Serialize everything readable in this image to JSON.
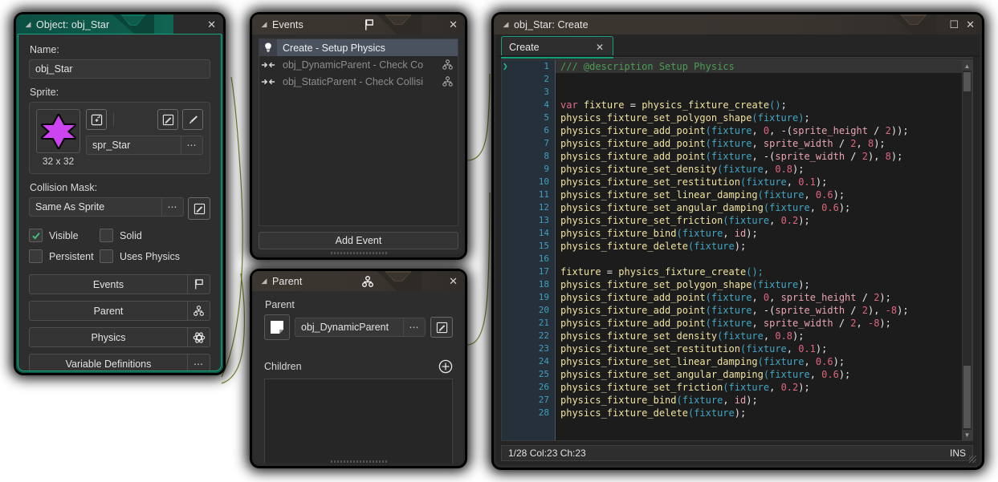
{
  "object_panel": {
    "title": "Object: obj_Star",
    "close_label": "✕",
    "name_label": "Name:",
    "name_value": "obj_Star",
    "sprite_label": "Sprite:",
    "sprite_name": "spr_Star",
    "sprite_dims": "32 x 32",
    "sprite_dots": "⋯",
    "collision_label": "Collision Mask:",
    "collision_value": "Same As Sprite",
    "collision_dots": "⋯",
    "checkboxes": [
      {
        "label": "Visible",
        "checked": true
      },
      {
        "label": "Solid",
        "checked": false
      },
      {
        "label": "Persistent",
        "checked": false
      },
      {
        "label": "Uses Physics",
        "checked": false
      }
    ],
    "buttons": [
      {
        "label": "Events",
        "icon": "flag-icon"
      },
      {
        "label": "Parent",
        "icon": "parent-tree-icon"
      },
      {
        "label": "Physics",
        "icon": "physics-gear-icon"
      },
      {
        "label": "Variable Definitions",
        "icon": "ellipsis-icon"
      }
    ],
    "variable_dots": "⋯",
    "accent_color": "#18a07c"
  },
  "events_panel": {
    "title": "Events",
    "close_label": "✕",
    "items": [
      {
        "label": "Create - Setup Physics",
        "icon": "lightbulb-icon",
        "selected": true,
        "trailing": ""
      },
      {
        "label": "obj_DynamicParent - Check Co",
        "icon": "collision-icon",
        "selected": false,
        "trailing": "parent-tree-icon"
      },
      {
        "label": "obj_StaticParent - Check Collisi",
        "icon": "collision-icon",
        "selected": false,
        "trailing": "parent-tree-icon"
      }
    ],
    "add_event_label": "Add Event"
  },
  "parent_panel": {
    "title": "Parent",
    "close_label": "✕",
    "parent_label": "Parent",
    "parent_value": "obj_DynamicParent",
    "parent_dots": "⋯",
    "children_label": "Children",
    "add_child_icon": "plus-circle-icon"
  },
  "code_panel": {
    "title": "obj_Star: Create",
    "maximize_label": "☐",
    "close_label": "✕",
    "tab_label": "Create",
    "tab_close": "✕",
    "status_left": "1/28 Col:23 Ch:23",
    "status_right": "INS",
    "lines": [
      {
        "n": 1,
        "current": true,
        "tokens": [
          {
            "t": "/// @description Setup Physics",
            "c": "k-com"
          }
        ]
      },
      {
        "n": 2,
        "current": false,
        "tokens": []
      },
      {
        "n": 3,
        "current": false,
        "tokens": []
      },
      {
        "n": 4,
        "current": false,
        "tokens": [
          {
            "t": "var",
            "c": "k-key"
          },
          {
            "t": " ",
            "c": "k-pl"
          },
          {
            "t": "fixture",
            "c": "k-fn"
          },
          {
            "t": " = ",
            "c": "k-pl"
          },
          {
            "t": "physics_fixture_create",
            "c": "k-fn"
          },
          {
            "t": "(",
            "c": "k-var"
          },
          {
            "t": ")",
            "c": "k-var"
          },
          {
            "t": ";",
            "c": "k-pl"
          }
        ]
      },
      {
        "n": 5,
        "current": false,
        "tokens": [
          {
            "t": "physics_fixture_set_polygon_shape",
            "c": "k-fn"
          },
          {
            "t": "(",
            "c": "k-var"
          },
          {
            "t": "fixture",
            "c": "k-var"
          },
          {
            "t": ")",
            "c": "k-var"
          },
          {
            "t": ";",
            "c": "k-pl"
          }
        ]
      },
      {
        "n": 6,
        "current": false,
        "tokens": [
          {
            "t": "physics_fixture_add_point",
            "c": "k-fn"
          },
          {
            "t": "(",
            "c": "k-var"
          },
          {
            "t": "fixture",
            "c": "k-var"
          },
          {
            "t": ", ",
            "c": "k-pl"
          },
          {
            "t": "0",
            "c": "k-num"
          },
          {
            "t": ", -(",
            "c": "k-pl"
          },
          {
            "t": "sprite_height",
            "c": "k-bi"
          },
          {
            "t": " / ",
            "c": "k-pl"
          },
          {
            "t": "2",
            "c": "k-num"
          },
          {
            "t": "));",
            "c": "k-pl"
          }
        ]
      },
      {
        "n": 7,
        "current": false,
        "tokens": [
          {
            "t": "physics_fixture_add_point",
            "c": "k-fn"
          },
          {
            "t": "(",
            "c": "k-var"
          },
          {
            "t": "fixture",
            "c": "k-var"
          },
          {
            "t": ", ",
            "c": "k-pl"
          },
          {
            "t": "sprite_width",
            "c": "k-bi"
          },
          {
            "t": " / ",
            "c": "k-pl"
          },
          {
            "t": "2",
            "c": "k-num"
          },
          {
            "t": ", ",
            "c": "k-pl"
          },
          {
            "t": "8",
            "c": "k-num"
          },
          {
            "t": ");",
            "c": "k-pl"
          }
        ]
      },
      {
        "n": 8,
        "current": false,
        "tokens": [
          {
            "t": "physics_fixture_add_point",
            "c": "k-fn"
          },
          {
            "t": "(",
            "c": "k-var"
          },
          {
            "t": "fixture",
            "c": "k-var"
          },
          {
            "t": ", -(",
            "c": "k-pl"
          },
          {
            "t": "sprite_width",
            "c": "k-bi"
          },
          {
            "t": " / ",
            "c": "k-pl"
          },
          {
            "t": "2",
            "c": "k-num"
          },
          {
            "t": "), ",
            "c": "k-pl"
          },
          {
            "t": "8",
            "c": "k-num"
          },
          {
            "t": ");",
            "c": "k-pl"
          }
        ]
      },
      {
        "n": 9,
        "current": false,
        "tokens": [
          {
            "t": "physics_fixture_set_density",
            "c": "k-fn"
          },
          {
            "t": "(",
            "c": "k-var"
          },
          {
            "t": "fixture",
            "c": "k-var"
          },
          {
            "t": ", ",
            "c": "k-pl"
          },
          {
            "t": "0.8",
            "c": "k-num"
          },
          {
            "t": ");",
            "c": "k-pl"
          }
        ]
      },
      {
        "n": 10,
        "current": false,
        "tokens": [
          {
            "t": "physics_fixture_set_restitution",
            "c": "k-fn"
          },
          {
            "t": "(",
            "c": "k-var"
          },
          {
            "t": "fixture",
            "c": "k-var"
          },
          {
            "t": ", ",
            "c": "k-pl"
          },
          {
            "t": "0.1",
            "c": "k-num"
          },
          {
            "t": ");",
            "c": "k-pl"
          }
        ]
      },
      {
        "n": 11,
        "current": false,
        "tokens": [
          {
            "t": "physics_fixture_set_linear_damping",
            "c": "k-fn"
          },
          {
            "t": "(",
            "c": "k-var"
          },
          {
            "t": "fixture",
            "c": "k-var"
          },
          {
            "t": ", ",
            "c": "k-pl"
          },
          {
            "t": "0.6",
            "c": "k-num"
          },
          {
            "t": ");",
            "c": "k-pl"
          }
        ]
      },
      {
        "n": 12,
        "current": false,
        "tokens": [
          {
            "t": "physics_fixture_set_angular_damping",
            "c": "k-fn"
          },
          {
            "t": "(",
            "c": "k-var"
          },
          {
            "t": "fixture",
            "c": "k-var"
          },
          {
            "t": ", ",
            "c": "k-pl"
          },
          {
            "t": "0.6",
            "c": "k-num"
          },
          {
            "t": ");",
            "c": "k-pl"
          }
        ]
      },
      {
        "n": 13,
        "current": false,
        "tokens": [
          {
            "t": "physics_fixture_set_friction",
            "c": "k-fn"
          },
          {
            "t": "(",
            "c": "k-var"
          },
          {
            "t": "fixture",
            "c": "k-var"
          },
          {
            "t": ", ",
            "c": "k-pl"
          },
          {
            "t": "0.2",
            "c": "k-num"
          },
          {
            "t": ");",
            "c": "k-pl"
          }
        ]
      },
      {
        "n": 14,
        "current": false,
        "tokens": [
          {
            "t": "physics_fixture_bind",
            "c": "k-fn"
          },
          {
            "t": "(",
            "c": "k-var"
          },
          {
            "t": "fixture",
            "c": "k-var"
          },
          {
            "t": ", ",
            "c": "k-pl"
          },
          {
            "t": "id",
            "c": "k-bi"
          },
          {
            "t": ");",
            "c": "k-pl"
          }
        ]
      },
      {
        "n": 15,
        "current": false,
        "tokens": [
          {
            "t": "physics_fixture_delete",
            "c": "k-fn"
          },
          {
            "t": "(",
            "c": "k-var"
          },
          {
            "t": "fixture",
            "c": "k-var"
          },
          {
            "t": ");",
            "c": "k-pl"
          }
        ]
      },
      {
        "n": 16,
        "current": false,
        "tokens": []
      },
      {
        "n": 17,
        "current": false,
        "tokens": [
          {
            "t": "fixture",
            "c": "k-fn"
          },
          {
            "t": " = ",
            "c": "k-pl"
          },
          {
            "t": "physics_fixture_create",
            "c": "k-fn"
          },
          {
            "t": "();",
            "c": "k-var"
          }
        ]
      },
      {
        "n": 18,
        "current": false,
        "tokens": [
          {
            "t": "physics_fixture_set_polygon_shape",
            "c": "k-fn"
          },
          {
            "t": "(",
            "c": "k-var"
          },
          {
            "t": "fixture",
            "c": "k-var"
          },
          {
            "t": ");",
            "c": "k-pl"
          }
        ]
      },
      {
        "n": 19,
        "current": false,
        "tokens": [
          {
            "t": "physics_fixture_add_point",
            "c": "k-fn"
          },
          {
            "t": "(",
            "c": "k-var"
          },
          {
            "t": "fixture",
            "c": "k-var"
          },
          {
            "t": ", ",
            "c": "k-pl"
          },
          {
            "t": "0",
            "c": "k-num"
          },
          {
            "t": ", ",
            "c": "k-pl"
          },
          {
            "t": "sprite_height",
            "c": "k-bi"
          },
          {
            "t": " / ",
            "c": "k-pl"
          },
          {
            "t": "2",
            "c": "k-num"
          },
          {
            "t": ");",
            "c": "k-pl"
          }
        ]
      },
      {
        "n": 20,
        "current": false,
        "tokens": [
          {
            "t": "physics_fixture_add_point",
            "c": "k-fn"
          },
          {
            "t": "(",
            "c": "k-var"
          },
          {
            "t": "fixture",
            "c": "k-var"
          },
          {
            "t": ", -(",
            "c": "k-pl"
          },
          {
            "t": "sprite_width",
            "c": "k-bi"
          },
          {
            "t": " / ",
            "c": "k-pl"
          },
          {
            "t": "2",
            "c": "k-num"
          },
          {
            "t": "), ",
            "c": "k-pl"
          },
          {
            "t": "-8",
            "c": "k-num"
          },
          {
            "t": ");",
            "c": "k-pl"
          }
        ]
      },
      {
        "n": 21,
        "current": false,
        "tokens": [
          {
            "t": "physics_fixture_add_point",
            "c": "k-fn"
          },
          {
            "t": "(",
            "c": "k-var"
          },
          {
            "t": "fixture",
            "c": "k-var"
          },
          {
            "t": ", ",
            "c": "k-pl"
          },
          {
            "t": "sprite_width",
            "c": "k-bi"
          },
          {
            "t": " / ",
            "c": "k-pl"
          },
          {
            "t": "2",
            "c": "k-num"
          },
          {
            "t": ", ",
            "c": "k-pl"
          },
          {
            "t": "-8",
            "c": "k-num"
          },
          {
            "t": ");",
            "c": "k-pl"
          }
        ]
      },
      {
        "n": 22,
        "current": false,
        "tokens": [
          {
            "t": "physics_fixture_set_density",
            "c": "k-fn"
          },
          {
            "t": "(",
            "c": "k-var"
          },
          {
            "t": "fixture",
            "c": "k-var"
          },
          {
            "t": ", ",
            "c": "k-pl"
          },
          {
            "t": "0.8",
            "c": "k-num"
          },
          {
            "t": ");",
            "c": "k-pl"
          }
        ]
      },
      {
        "n": 23,
        "current": false,
        "tokens": [
          {
            "t": "physics_fixture_set_restitution",
            "c": "k-fn"
          },
          {
            "t": "(",
            "c": "k-var"
          },
          {
            "t": "fixture",
            "c": "k-var"
          },
          {
            "t": ", ",
            "c": "k-pl"
          },
          {
            "t": "0.1",
            "c": "k-num"
          },
          {
            "t": ");",
            "c": "k-pl"
          }
        ]
      },
      {
        "n": 24,
        "current": false,
        "tokens": [
          {
            "t": "physics_fixture_set_linear_damping",
            "c": "k-fn"
          },
          {
            "t": "(",
            "c": "k-var"
          },
          {
            "t": "fixture",
            "c": "k-var"
          },
          {
            "t": ", ",
            "c": "k-pl"
          },
          {
            "t": "0.6",
            "c": "k-num"
          },
          {
            "t": ");",
            "c": "k-pl"
          }
        ]
      },
      {
        "n": 25,
        "current": false,
        "tokens": [
          {
            "t": "physics_fixture_set_angular_damping",
            "c": "k-fn"
          },
          {
            "t": "(",
            "c": "k-var"
          },
          {
            "t": "fixture",
            "c": "k-var"
          },
          {
            "t": ", ",
            "c": "k-pl"
          },
          {
            "t": "0.6",
            "c": "k-num"
          },
          {
            "t": ");",
            "c": "k-pl"
          }
        ]
      },
      {
        "n": 26,
        "current": false,
        "tokens": [
          {
            "t": "physics_fixture_set_friction",
            "c": "k-fn"
          },
          {
            "t": "(",
            "c": "k-var"
          },
          {
            "t": "fixture",
            "c": "k-var"
          },
          {
            "t": ", ",
            "c": "k-pl"
          },
          {
            "t": "0.2",
            "c": "k-num"
          },
          {
            "t": ");",
            "c": "k-pl"
          }
        ]
      },
      {
        "n": 27,
        "current": false,
        "tokens": [
          {
            "t": "physics_fixture_bind",
            "c": "k-fn"
          },
          {
            "t": "(",
            "c": "k-var"
          },
          {
            "t": "fixture",
            "c": "k-var"
          },
          {
            "t": ", ",
            "c": "k-pl"
          },
          {
            "t": "id",
            "c": "k-bi"
          },
          {
            "t": ");",
            "c": "k-pl"
          }
        ]
      },
      {
        "n": 28,
        "current": false,
        "tokens": [
          {
            "t": "physics_fixture_delete",
            "c": "k-fn"
          },
          {
            "t": "(",
            "c": "k-var"
          },
          {
            "t": "fixture",
            "c": "k-var"
          },
          {
            "t": ");",
            "c": "k-pl"
          }
        ]
      }
    ]
  }
}
